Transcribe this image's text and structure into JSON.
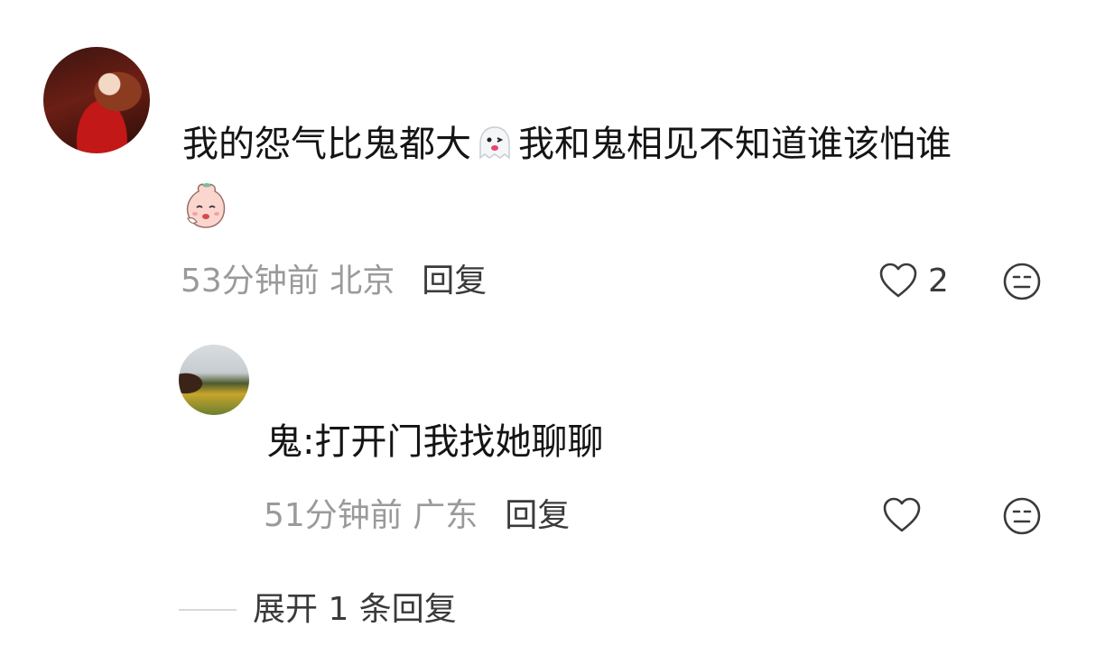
{
  "comment": {
    "text_part1": "我的怨气比鬼都大",
    "text_part2": "我和鬼相见不知道谁该怕谁",
    "inline_emoji": "ghost-emoji",
    "trailing_emoji": "sad-peach-emoji",
    "time": "53分钟前 北京",
    "reply_label": "回复",
    "like_count": "2",
    "like_icon": "heart-outline-icon",
    "dislike_icon": "meh-face-icon"
  },
  "reply": {
    "text": "鬼:打开门我找她聊聊",
    "time": "51分钟前 广东",
    "reply_label": "回复",
    "like_icon": "heart-outline-icon",
    "dislike_icon": "meh-face-icon"
  },
  "expand": {
    "label": "展开 1 条回复"
  },
  "colors": {
    "text": "#141414",
    "meta": "#9a9a9a",
    "action": "#3a3a3a"
  }
}
